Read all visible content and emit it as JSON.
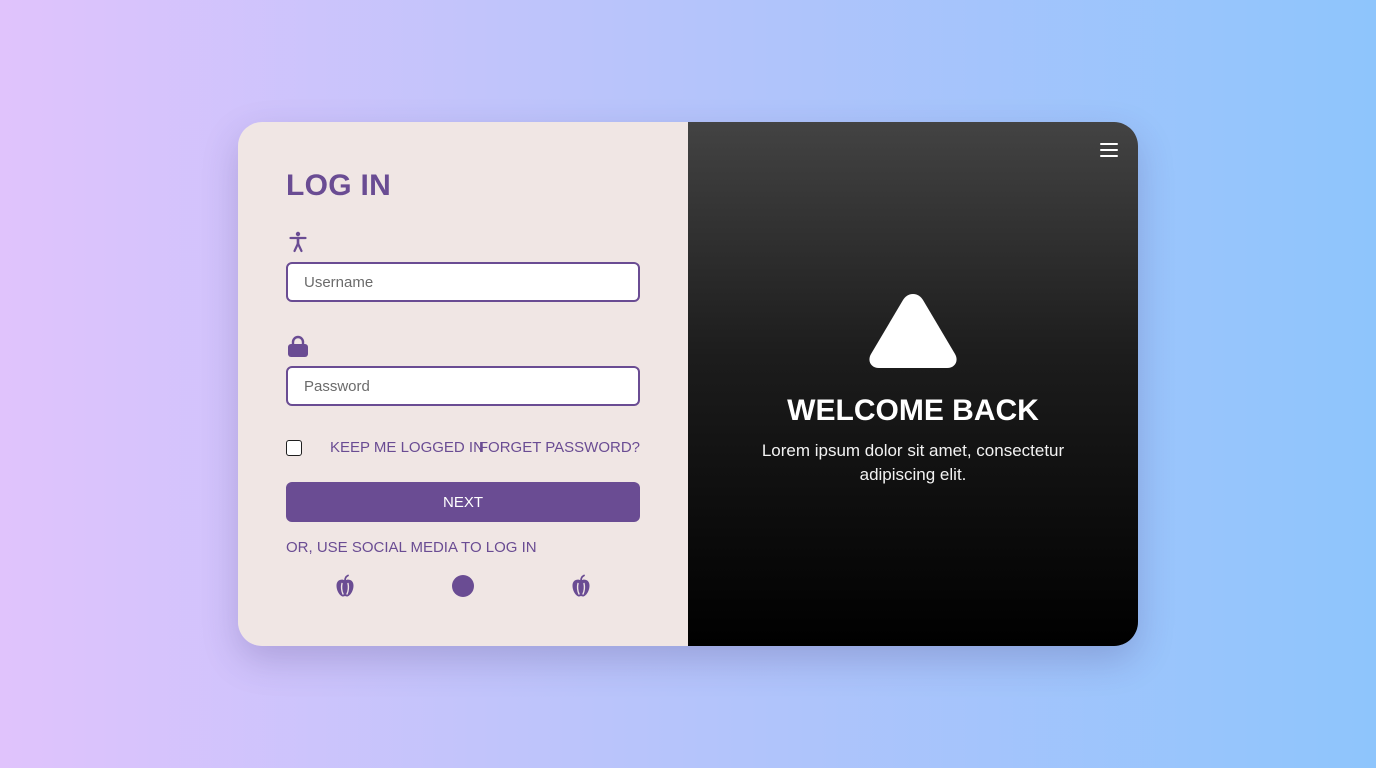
{
  "login": {
    "title": "LOG IN",
    "username": {
      "placeholder": "Username",
      "value": "",
      "icon": "accessibility-person-icon"
    },
    "password": {
      "placeholder": "Password",
      "value": "",
      "icon": "lock-icon"
    },
    "keep_logged_in": {
      "label": "KEEP ME LOGGED IN",
      "checked": false
    },
    "forget_password": "FORGET PASSWORD?",
    "next_button": "NEXT",
    "social_label": "OR, USE SOCIAL MEDIA TO LOG IN",
    "social_icons": [
      "apple-icon",
      "circle-icon",
      "apple-icon"
    ]
  },
  "welcome": {
    "title": "WELCOME BACK",
    "text": "Lorem ipsum dolor sit amet, consectetur adipiscing elit.",
    "logo_icon": "triangle-logo-icon",
    "menu_icon": "hamburger-menu-icon"
  },
  "colors": {
    "accent": "#6a4c93",
    "left_panel_bg": "#f0e6e4",
    "right_panel_gradient": [
      "#434343",
      "#000000"
    ],
    "page_gradient": [
      "#e0c3fc",
      "#8ec5fc"
    ]
  }
}
